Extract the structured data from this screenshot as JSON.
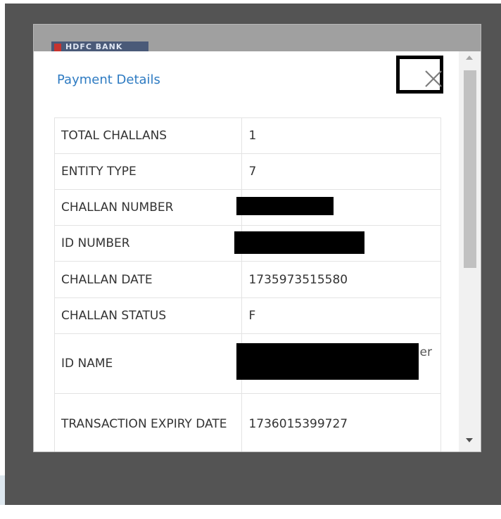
{
  "modal": {
    "bank_logo_text": "HDFC BANK",
    "title": "Payment Details",
    "close_icon": "close-icon"
  },
  "details": {
    "rows": [
      {
        "label": "TOTAL CHALLANS",
        "value": "1"
      },
      {
        "label": "ENTITY TYPE",
        "value": "7"
      },
      {
        "label": "CHALLAN NUMBER",
        "value": ""
      },
      {
        "label": "ID NUMBER",
        "value": ""
      },
      {
        "label": "CHALLAN DATE",
        "value": "1735973515580"
      },
      {
        "label": "CHALLAN STATUS",
        "value": "F"
      },
      {
        "label": "ID NAME",
        "value": "er"
      },
      {
        "label": "TRANSACTION EXPIRY DATE",
        "value": "1736015399727"
      }
    ]
  },
  "colors": {
    "title": "#2e7bc2",
    "overlay": "#545454",
    "redaction": "#000000"
  }
}
